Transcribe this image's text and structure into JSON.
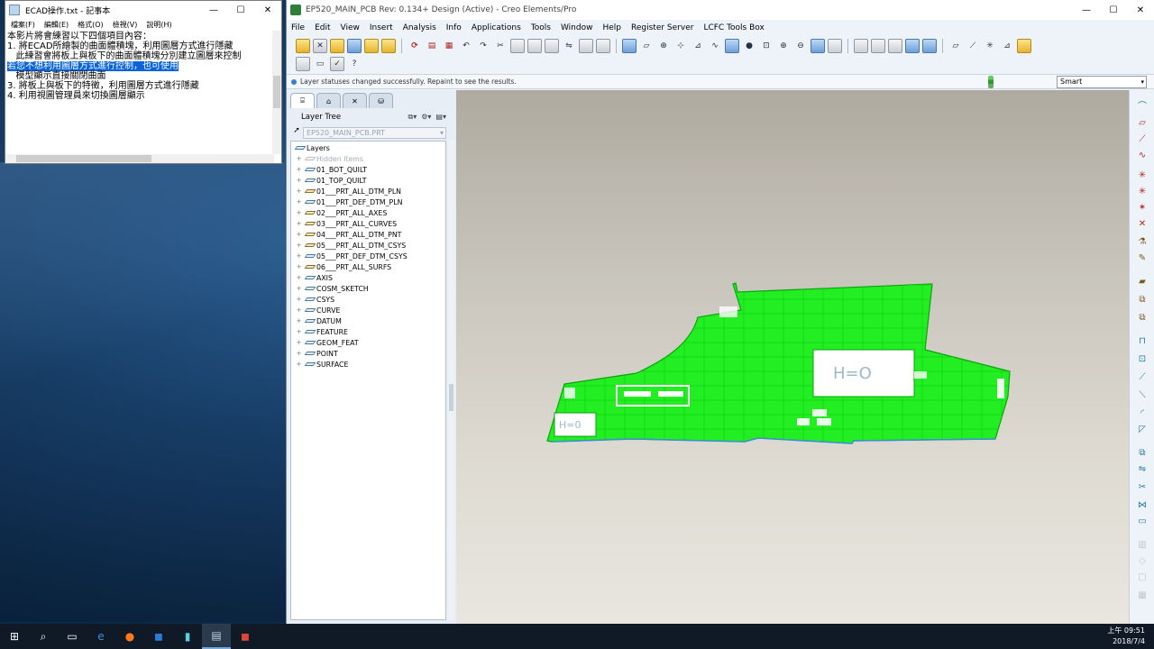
{
  "notepad": {
    "title": "ECAD操作.txt - 記事本",
    "menu": [
      "檔案(F)",
      "編輯(E)",
      "格式(O)",
      "檢視(V)",
      "說明(H)"
    ],
    "lines": [
      "本影片將會練習以下四個項目內容：",
      "",
      "1. 將ECAD所繪製的曲面體積塊，利用圖層方式進行隱藏",
      "   此練習會將板上與板下的曲面體積塊分別建立圖層來控制",
      "",
      "2. 若您不想利用圖層方式進行控制，也可使用",
      "   模型顯示直接關閉曲面",
      "",
      "3. 將板上與板下的特徵，利用圖層方式進行隱藏",
      "",
      "4. 利用視圖管理員來切換圖層顯示"
    ],
    "highlight_line": "若您不想利用圖層方式進行控制，也可使用"
  },
  "creo": {
    "title": "EP520_MAIN_PCB Rev: 0.134+ Design (Active) - Creo Elements/Pro",
    "menu": [
      "File",
      "Edit",
      "View",
      "Insert",
      "Analysis",
      "Info",
      "Applications",
      "Tools",
      "Window",
      "Help",
      "Register Server",
      "LCFC Tools Box"
    ],
    "status_message": "Layer statuses changed successfully. Repaint to see the results.",
    "filter_value": "Smart",
    "nav": {
      "panel_title": "Layer Tree",
      "model": "EP520_MAIN_PCB.PRT",
      "root": "Layers",
      "layers": [
        {
          "name": "Hidden Items",
          "icon": "plain",
          "dim": true
        },
        {
          "name": "01_BOT_QUILT",
          "icon": "plain",
          "dim": false
        },
        {
          "name": "01_TOP_QUILT",
          "icon": "plain",
          "dim": false
        },
        {
          "name": "01___PRT_ALL_DTM_PLN",
          "icon": "rule",
          "dim": false
        },
        {
          "name": "01___PRT_DEF_DTM_PLN",
          "icon": "plain",
          "dim": false
        },
        {
          "name": "02___PRT_ALL_AXES",
          "icon": "rule",
          "dim": false
        },
        {
          "name": "03___PRT_ALL_CURVES",
          "icon": "rule",
          "dim": false
        },
        {
          "name": "04___PRT_ALL_DTM_PNT",
          "icon": "rule",
          "dim": false
        },
        {
          "name": "05___PRT_ALL_DTM_CSYS",
          "icon": "rule",
          "dim": false
        },
        {
          "name": "05___PRT_DEF_DTM_CSYS",
          "icon": "plain",
          "dim": false
        },
        {
          "name": "06___PRT_ALL_SURFS",
          "icon": "rule",
          "dim": false
        },
        {
          "name": "AXIS",
          "icon": "plain",
          "dim": false
        },
        {
          "name": "COSM_SKETCH",
          "icon": "plain",
          "dim": false
        },
        {
          "name": "CSYS",
          "icon": "plain",
          "dim": false
        },
        {
          "name": "CURVE",
          "icon": "plain",
          "dim": false
        },
        {
          "name": "DATUM",
          "icon": "plain",
          "dim": false
        },
        {
          "name": "FEATURE",
          "icon": "plain",
          "dim": false
        },
        {
          "name": "GEOM_FEAT",
          "icon": "plain",
          "dim": false
        },
        {
          "name": "POINT",
          "icon": "plain",
          "dim": false
        },
        {
          "name": "SURFACE",
          "icon": "plain",
          "dim": false
        }
      ]
    },
    "model_labels": [
      "H=O",
      "H=0"
    ],
    "colors": {
      "pcb": "#22ee22",
      "pcb_edge": "#0aa30a",
      "keepout": "#ffffff"
    }
  },
  "taskbar": {
    "time": "上午 09:51",
    "date": "2018/7/4"
  }
}
